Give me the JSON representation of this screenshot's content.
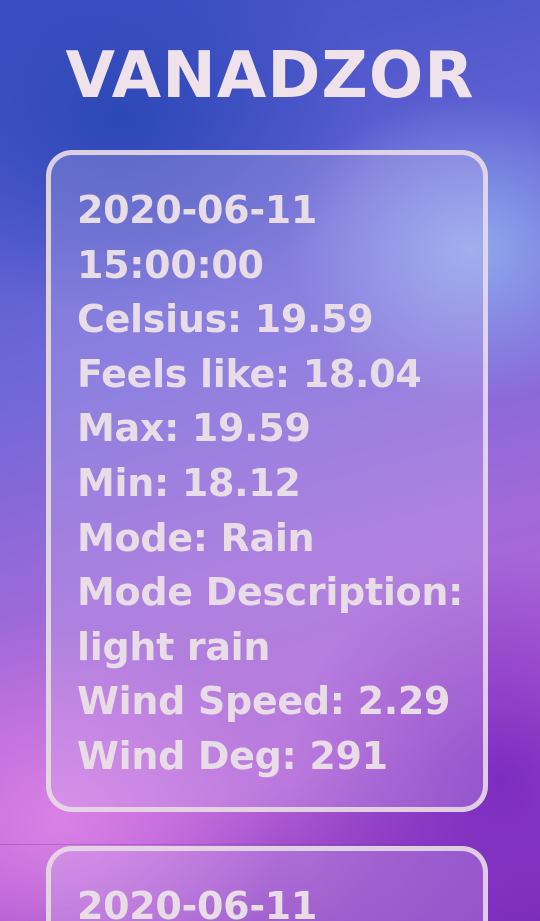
{
  "city": "VANADZOR",
  "forecasts": [
    {
      "date": "2020-06-11",
      "time": "15:00:00",
      "celsius": "Celsius:  19.59",
      "feels_like": "Feels like:  18.04",
      "max": "Max:  19.59",
      "min": "Min:  18.12",
      "mode": "Mode:  Rain",
      "mode_description_label": "Mode Description:",
      "mode_description_value": "light rain",
      "wind_speed": "Wind Speed:  2.29",
      "wind_deg": "Wind Deg:  291"
    },
    {
      "date": "2020-06-11"
    }
  ]
}
